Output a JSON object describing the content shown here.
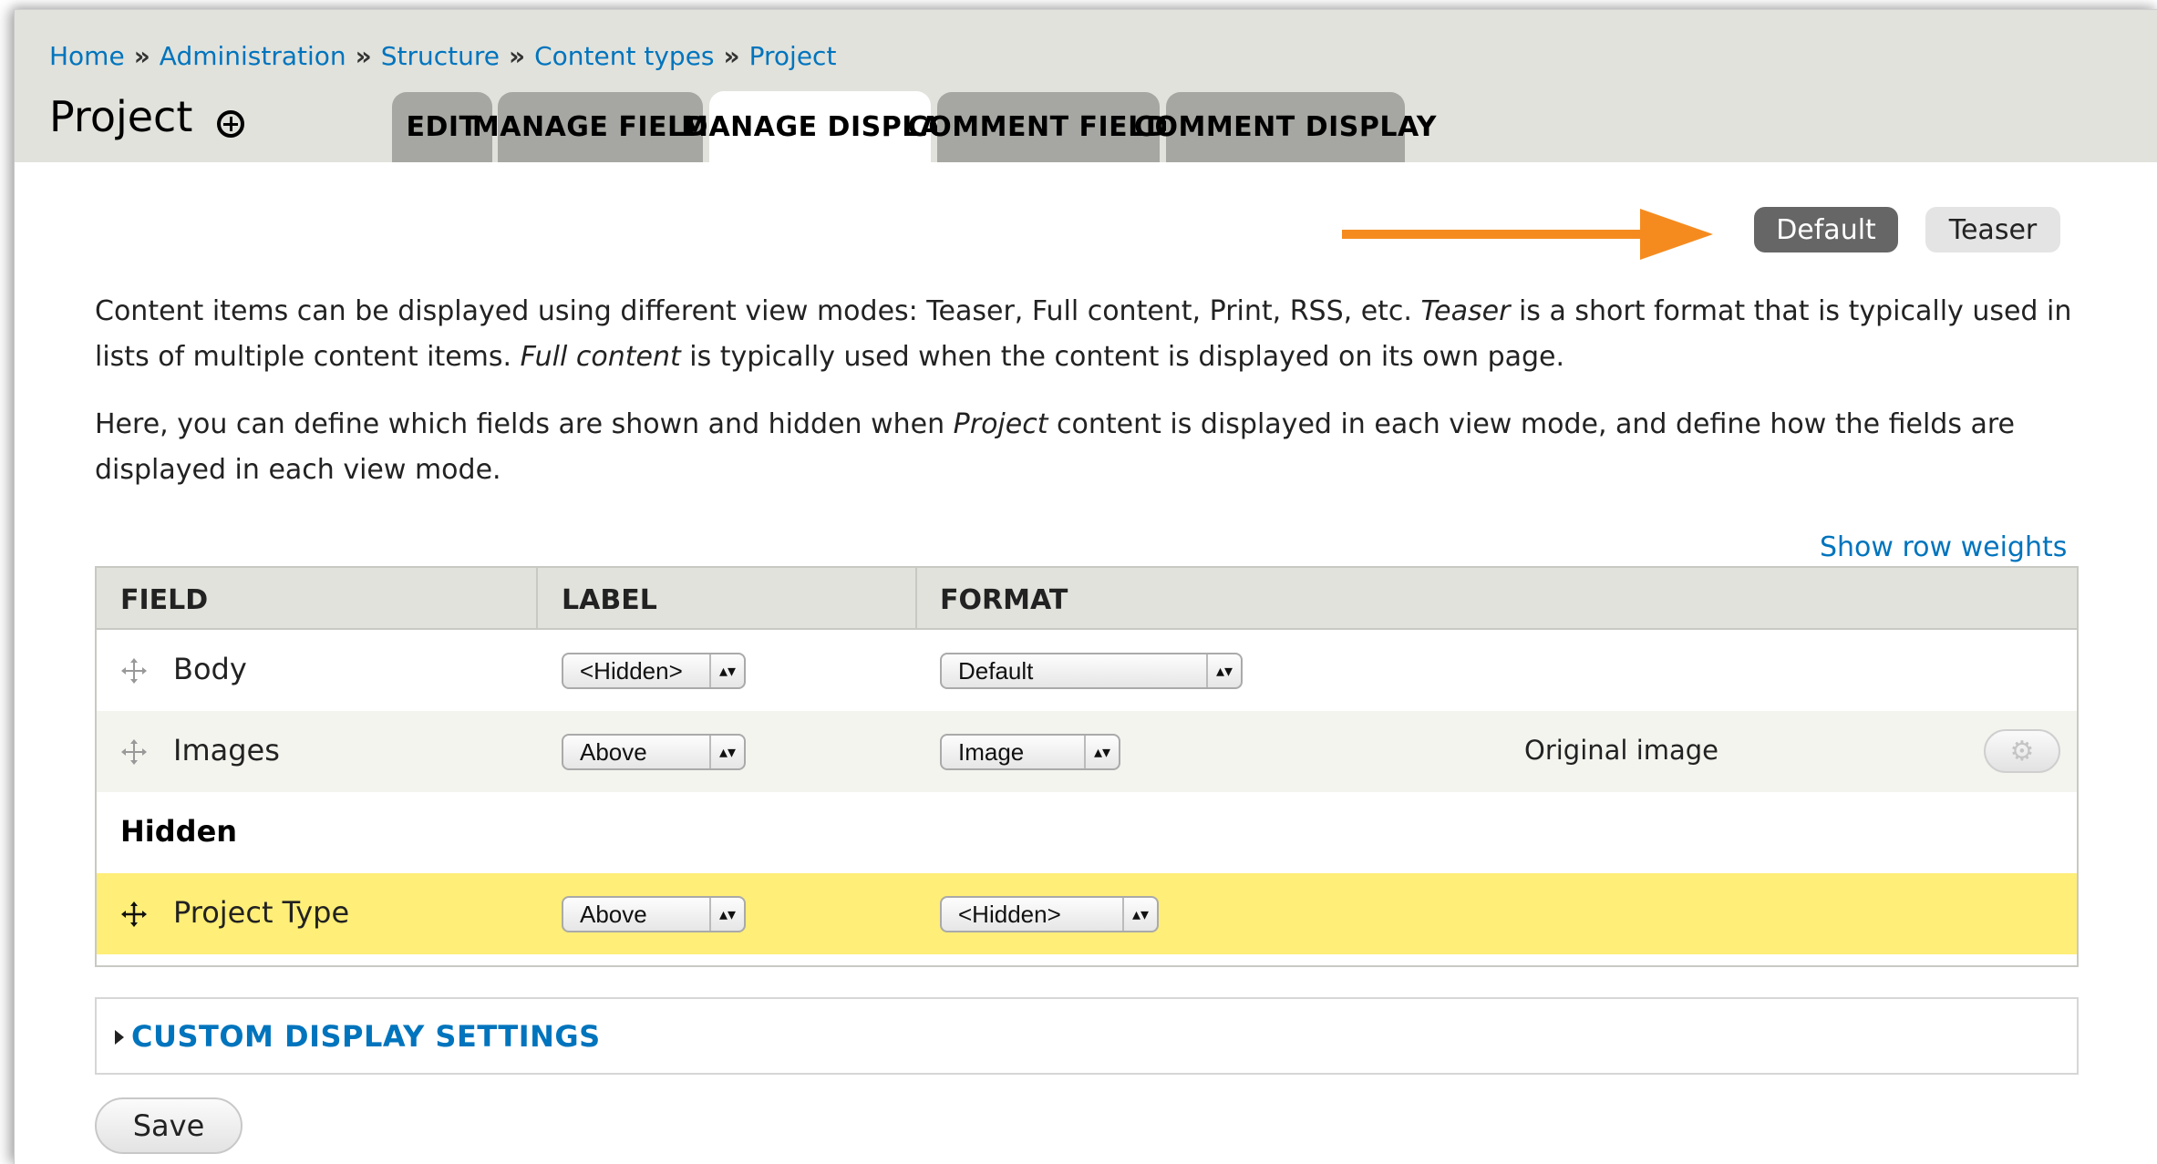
{
  "breadcrumb": {
    "home": "Home",
    "administration": "Administration",
    "structure": "Structure",
    "content_types": "Content types",
    "project": "Project",
    "separator": "»"
  },
  "page_title": "Project",
  "tabs": [
    {
      "label": "EDIT",
      "active": false
    },
    {
      "label": "MANAGE FIELDS",
      "active": false
    },
    {
      "label": "MANAGE DISPLAY",
      "active": true
    },
    {
      "label": "COMMENT FIELDS",
      "active": false
    },
    {
      "label": "COMMENT DISPLAY",
      "active": false
    }
  ],
  "view_modes": {
    "default_label": "Default",
    "teaser_label": "Teaser",
    "selected": "Default"
  },
  "description": {
    "p1_a": "Content items can be displayed using different view modes: Teaser, Full content, Print, RSS, etc. ",
    "p1_em1": "Teaser",
    "p1_b": " is a short format that is typically used in lists of multiple content items. ",
    "p1_em2": "Full content",
    "p1_c": " is typically used when the content is displayed on its own page.",
    "p2_a": "Here, you can define which fields are shown and hidden when ",
    "p2_em": "Project",
    "p2_b": " content is displayed in each view mode, and define how the fields are displayed in each view mode."
  },
  "show_row_weights": "Show row weights",
  "table": {
    "headers": {
      "field": "FIELD",
      "label": "LABEL",
      "format": "FORMAT"
    },
    "rows": [
      {
        "field": "Body",
        "label": "<Hidden>",
        "format": "Default",
        "summary": ""
      },
      {
        "field": "Images",
        "label": "Above",
        "format": "Image",
        "summary": "Original image"
      }
    ],
    "hidden_region": "Hidden",
    "hidden_rows": [
      {
        "field": "Project Type",
        "label": "Above",
        "format": "<Hidden>"
      }
    ]
  },
  "custom_display_settings": "CUSTOM DISPLAY SETTINGS",
  "save_label": "Save",
  "colors": {
    "accent_arrow": "#f58b1f",
    "link": "#0074bd",
    "highlight_row": "#ffee77",
    "header_bg": "#e1e2dc",
    "tab_bg": "#a6a7a2"
  },
  "icons": {
    "title_action": "plus-circle-icon",
    "drag": "move-cross-icon",
    "settings": "gear-icon",
    "select_arrow": "updown-arrow-icon",
    "collapse": "triangle-right-icon"
  }
}
